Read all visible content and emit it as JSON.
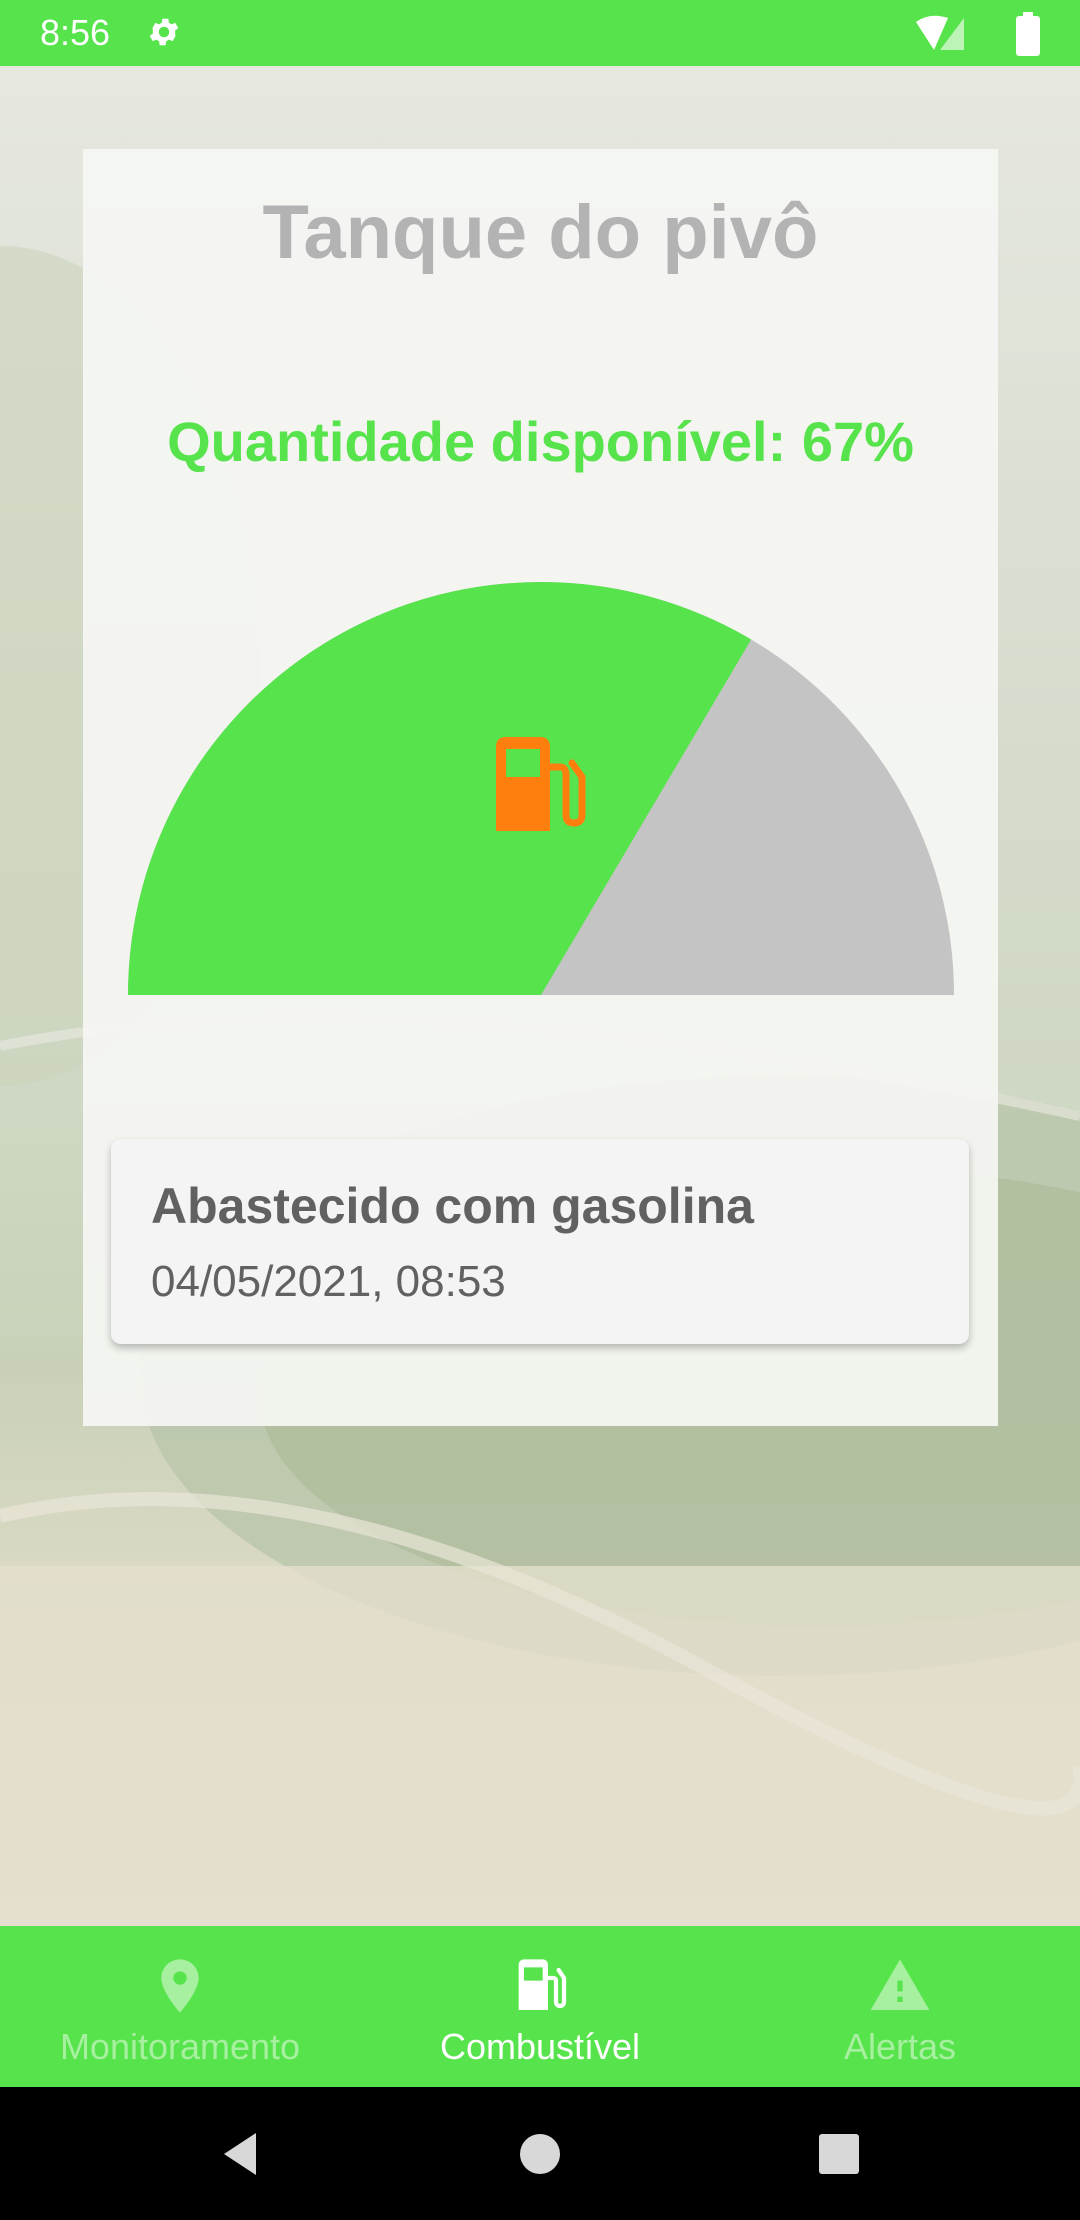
{
  "status_bar": {
    "time": "8:56",
    "icons": [
      "gear-icon",
      "wifi-icon",
      "signal-icon",
      "battery-icon"
    ]
  },
  "panel": {
    "title": "Tanque do pivô",
    "quantity_text": "Quantidade disponível: 67%",
    "gauge": {
      "level_percent": 67,
      "fill_color": "#57e34b",
      "empty_color": "#c4c4c4",
      "icon": "fuel-pump-icon",
      "icon_color": "#ff7f0e"
    }
  },
  "event_card": {
    "title": "Abastecido com gasolina",
    "datetime": "04/05/2021, 08:53"
  },
  "bottom_nav": {
    "items": [
      {
        "label": "Monitoramento",
        "icon": "location-pin-icon",
        "active": false
      },
      {
        "label": "Combustível",
        "icon": "fuel-pump-icon",
        "active": true
      },
      {
        "label": "Alertas",
        "icon": "warning-icon",
        "active": false
      }
    ]
  },
  "colors": {
    "accent": "#57e34b",
    "title_gray": "#b3b3b3",
    "text_dark": "#616161"
  }
}
